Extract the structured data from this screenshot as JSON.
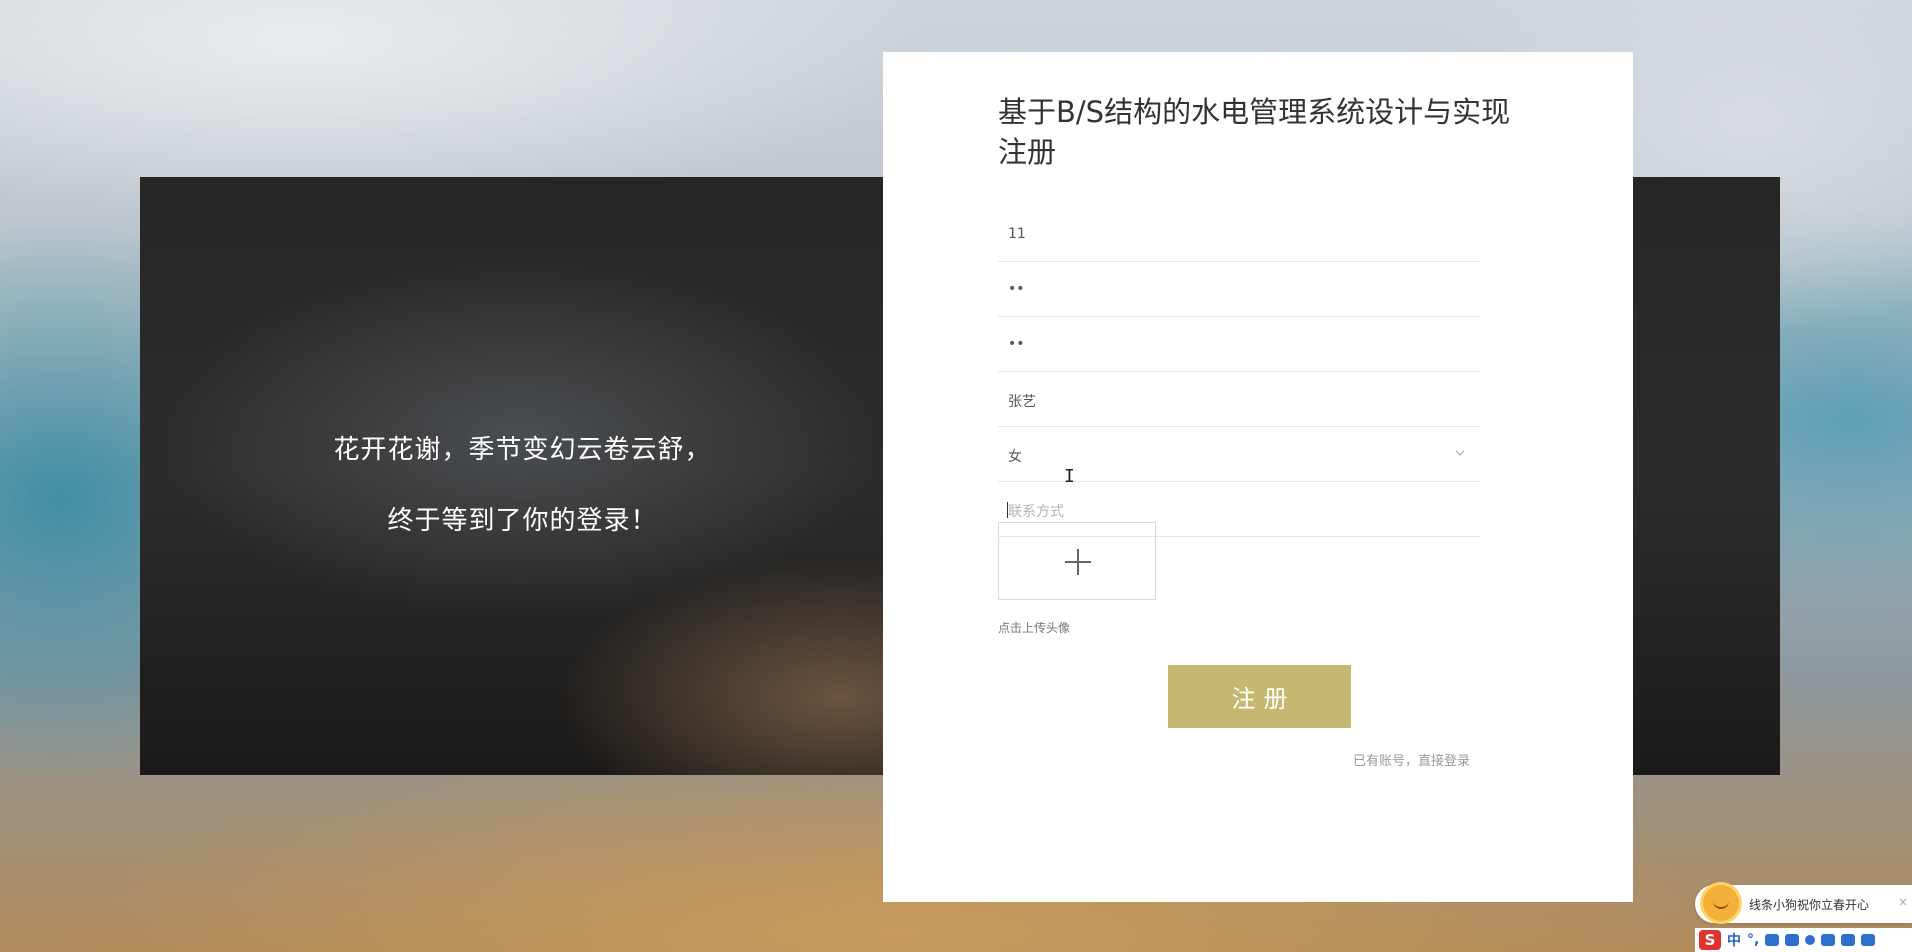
{
  "hero": {
    "line1": "花开花谢，季节变幻云卷云舒，",
    "line2": "终于等到了你的登录！"
  },
  "form": {
    "title": "基于B/S结构的水电管理系统设计与实现注册",
    "fields": [
      {
        "name": "account",
        "value": "11"
      },
      {
        "name": "password",
        "value": "••"
      },
      {
        "name": "confirm",
        "value": "••"
      },
      {
        "name": "name",
        "value": "张艺"
      },
      {
        "name": "gender",
        "value": "女"
      },
      {
        "name": "contact",
        "placeholder": "联系方式"
      }
    ],
    "upload_label": "点击上传头像",
    "submit_label": "注册",
    "login_link": "已有账号，直接登录"
  },
  "notification": {
    "text": "线条小狗祝你立春开心",
    "close": "×"
  },
  "ime": {
    "logo": "S",
    "mode": "中",
    "punct": "°,"
  },
  "colors": {
    "accent": "#c6b870",
    "panel_bg": "#ffffff",
    "band_bg": "#262626"
  }
}
